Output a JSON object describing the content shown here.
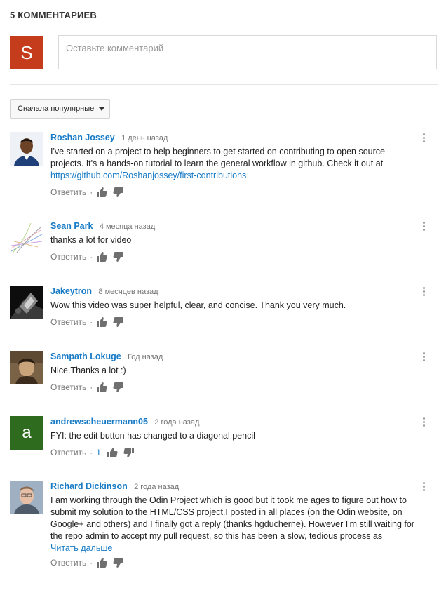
{
  "comments_section": {
    "count_label": "5 КОММЕНТАРИЕВ",
    "composer": {
      "avatar_letter": "S",
      "avatar_color": "#c43c1b",
      "placeholder": "Оставьте комментарий"
    },
    "sort_label": "Сначала популярные",
    "reply_label": "Ответить",
    "read_more_label": "Читать дальше",
    "comments": [
      {
        "author": "Roshan Jossey",
        "time": "1 день назад",
        "text": "I've started on a project to help beginners to get started on contributing to open source projects. It's a hands-on tutorial to learn the general workflow in github. Check it out at",
        "link": "https://github.com/Roshanjossey/first-contributions"
      },
      {
        "author": "Sean Park",
        "time": "4 месяца назад",
        "text": "thanks a lot for video"
      },
      {
        "author": "Jakeytron",
        "time": "8 месяцев назад",
        "text": "Wow this video was super helpful, clear, and concise. Thank you very much."
      },
      {
        "author": "Sampath Lokuge",
        "time": "Год назад",
        "text": "Nice.Thanks a lot :)"
      },
      {
        "author": "andrewscheuermann05",
        "time": "2 года назад",
        "text": "FYI: the edit button has changed to a diagonal pencil",
        "avatar_letter": "a",
        "avatar_color": "#2e6b1f",
        "like_count": "1"
      },
      {
        "author": "Richard Dickinson",
        "time": "2 года назад",
        "text": "I am working through the Odin Project which is good but it took me ages to figure out how to submit my solution to the HTML/CSS project.I posted in all places (on the Odin website, on Google+ and others) and I finally got a reply (thanks hgducherne). However I'm still waiting for the repo admin to accept my pull request, so this has been a slow, tedious process as"
      }
    ]
  }
}
